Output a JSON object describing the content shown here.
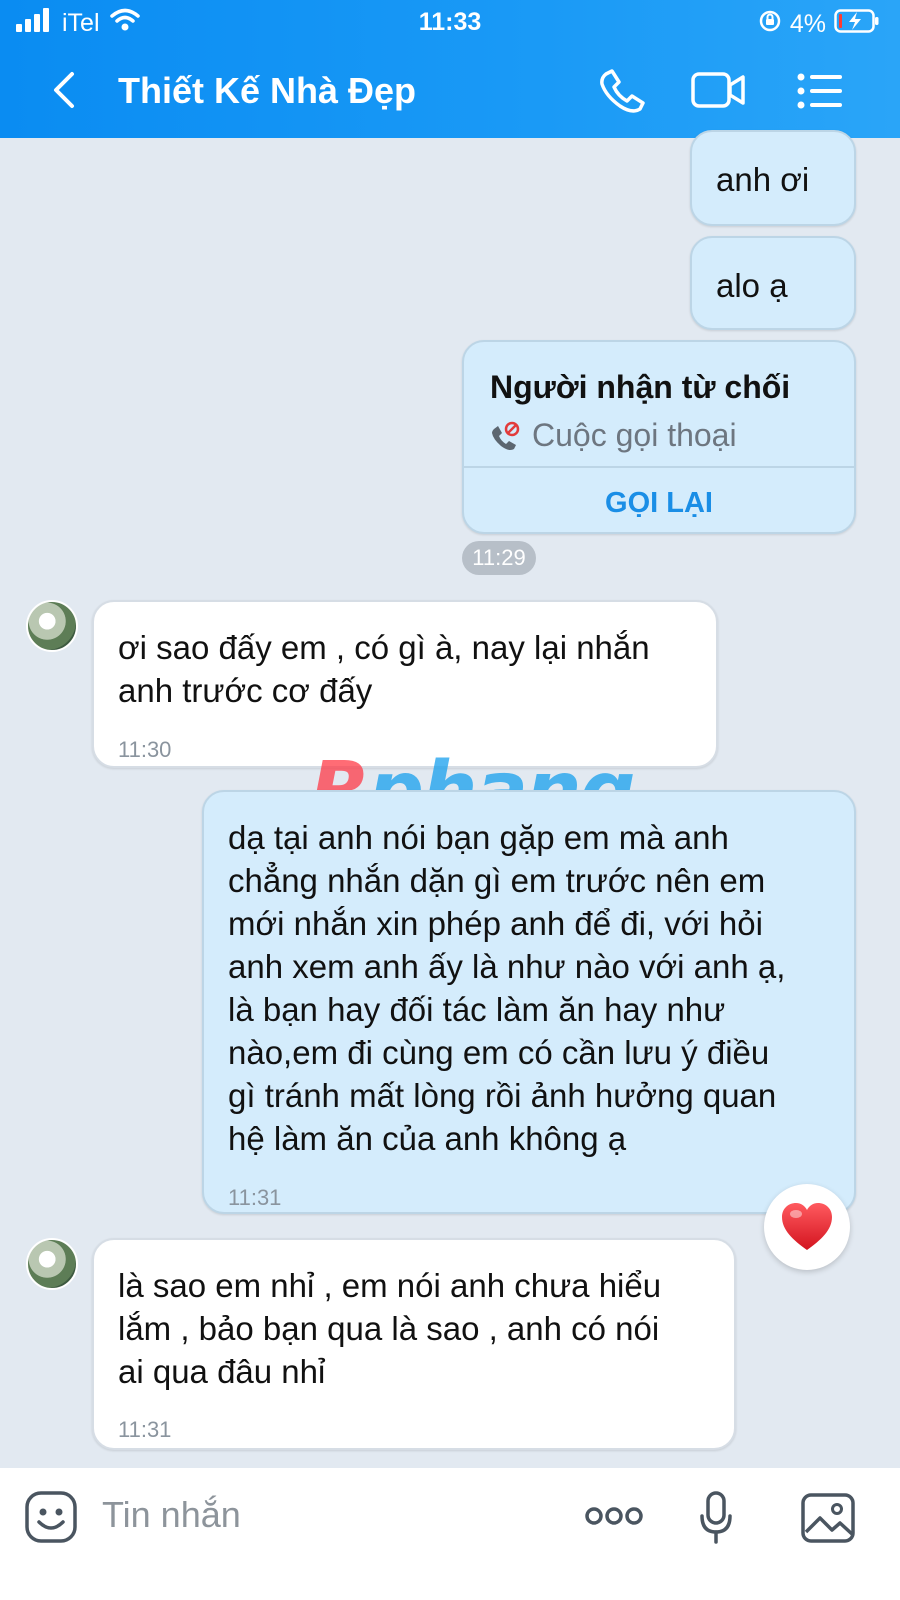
{
  "status": {
    "carrier": "iTel",
    "time": "11:33",
    "battery": "4%"
  },
  "header": {
    "title": "Thiết Kế Nhà Đẹp"
  },
  "messages": {
    "m1": {
      "text": "anh ơi"
    },
    "m2": {
      "text": "alo ạ"
    },
    "call": {
      "title": "Người nhận từ chối",
      "subtitle": "Cuộc gọi thoại",
      "action": "GỌI LẠI"
    },
    "time_pill": "11:29",
    "r1": {
      "lines": [
        "ơi sao đấy em , có gì à, nay lại nhắn",
        "anh trước cơ đấy"
      ],
      "time": "11:30"
    },
    "s1": {
      "lines": [
        "dạ tại anh nói bạn gặp em mà anh",
        "chẳng nhắn dặn gì em trước nên em",
        "mới nhắn xin phép anh để đi, với hỏi",
        "anh xem anh ấy là như nào với anh ạ,",
        "là bạn hay đối tác làm ăn hay như",
        "nào,em đi cùng em có cần lưu ý điều",
        "gì tránh mất lòng rồi ảnh hưởng quan",
        "hệ làm ăn của anh không ạ"
      ],
      "time": "11:31",
      "reaction": "heart"
    },
    "r2": {
      "lines": [
        "là sao em nhỉ , em nói anh chưa hiểu",
        "lắm , bảo bạn qua là sao , anh có nói",
        "ai qua đâu nhỉ"
      ],
      "time": "11:31"
    }
  },
  "watermark": "Rphang",
  "input": {
    "placeholder": "Tin nhắn"
  },
  "colors": {
    "header": "#0a8cf2",
    "mine_bubble": "#d4ecfc",
    "theirs_bubble": "#ffffff",
    "accent": "#1a8ee6",
    "heart": "#e8202a"
  }
}
